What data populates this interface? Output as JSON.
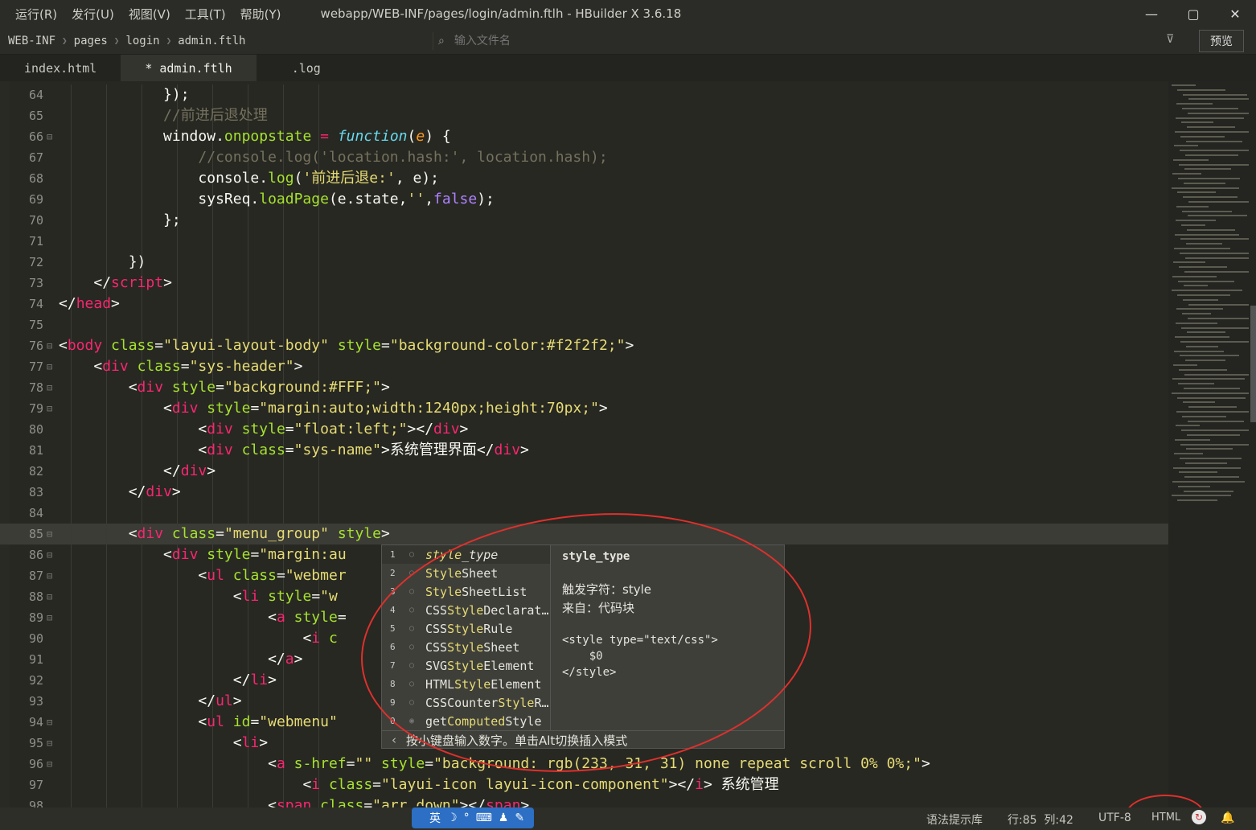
{
  "menubar": [
    "运行(R)",
    "发行(U)",
    "视图(V)",
    "工具(T)",
    "帮助(Y)"
  ],
  "window_title": "webapp/WEB-INF/pages/login/admin.ftlh - HBuilder X 3.6.18",
  "window_controls": {
    "minimize": "—",
    "maximize": "▢",
    "close": "✕"
  },
  "breadcrumb": [
    "WEB-INF",
    "pages",
    "login",
    "admin.ftlh"
  ],
  "file_search": {
    "placeholder": "输入文件名"
  },
  "preview_label": "预览",
  "tabs": [
    {
      "label": "index.html",
      "active": false
    },
    {
      "label": "* admin.ftlh",
      "active": true
    },
    {
      "label": ".log",
      "active": false
    }
  ],
  "editor": {
    "current_line": 85,
    "lines": [
      {
        "n": "64",
        "fold": false,
        "html": "            <span class='p'>});</span>"
      },
      {
        "n": "65",
        "fold": false,
        "html": "            <span class='c'>//前进后退处理</span>"
      },
      {
        "n": "66",
        "fold": true,
        "html": "            <span class='p'>window.</span><span class='a'>onpopstate</span> <span class='t'>=</span> <span class='f'>function</span><span class='p'>(</span><span class='v'>e</span><span class='p'>) {</span>"
      },
      {
        "n": "67",
        "fold": false,
        "html": "                <span class='c'>//console.log('location.hash:', location.hash);</span>"
      },
      {
        "n": "68",
        "fold": false,
        "html": "                <span class='p'>console.</span><span class='a'>log</span><span class='p'>(</span><span class='s'>'前进后退e:'</span><span class='p'>, e);</span>"
      },
      {
        "n": "69",
        "fold": false,
        "html": "                <span class='p'>sysReq.</span><span class='a'>loadPage</span><span class='p'>(e.state,</span><span class='s'>''</span><span class='p'>,</span><span class='k'>false</span><span class='p'>);</span>"
      },
      {
        "n": "70",
        "fold": false,
        "html": "            <span class='p'>};</span>"
      },
      {
        "n": "71",
        "fold": false,
        "html": ""
      },
      {
        "n": "72",
        "fold": false,
        "html": "        <span class='p'>})</span>"
      },
      {
        "n": "73",
        "fold": false,
        "html": "    <span class='p'>&lt;/</span><span class='t'>script</span><span class='p'>&gt;</span>"
      },
      {
        "n": "74",
        "fold": false,
        "html": "<span class='p'>&lt;/</span><span class='t'>head</span><span class='p'>&gt;</span>"
      },
      {
        "n": "75",
        "fold": false,
        "html": ""
      },
      {
        "n": "76",
        "fold": true,
        "html": "<span class='p'>&lt;</span><span class='t'>body</span> <span class='a'>class</span><span class='p'>=</span><span class='s'>\"layui-layout-body\"</span> <span class='a'>style</span><span class='p'>=</span><span class='s'>\"background-color:#f2f2f2;\"</span><span class='p'>&gt;</span>"
      },
      {
        "n": "77",
        "fold": true,
        "html": "    <span class='p'>&lt;</span><span class='t'>div</span> <span class='a'>class</span><span class='p'>=</span><span class='s'>\"sys-header\"</span><span class='p'>&gt;</span>"
      },
      {
        "n": "78",
        "fold": true,
        "html": "        <span class='p'>&lt;</span><span class='t'>div</span> <span class='a'>style</span><span class='p'>=</span><span class='s'>\"background:#FFF;\"</span><span class='p'>&gt;</span>"
      },
      {
        "n": "79",
        "fold": true,
        "html": "            <span class='p'>&lt;</span><span class='t'>div</span> <span class='a'>style</span><span class='p'>=</span><span class='s'>\"margin:auto;width:1240px;height:70px;\"</span><span class='p'>&gt;</span>"
      },
      {
        "n": "80",
        "fold": false,
        "html": "                <span class='p'>&lt;</span><span class='t'>div</span> <span class='a'>style</span><span class='p'>=</span><span class='s'>\"float:left;\"</span><span class='p'>&gt;&lt;/</span><span class='t'>div</span><span class='p'>&gt;</span>"
      },
      {
        "n": "81",
        "fold": false,
        "html": "                <span class='p'>&lt;</span><span class='t'>div</span> <span class='a'>class</span><span class='p'>=</span><span class='s'>\"sys-name\"</span><span class='p'>&gt;系统管理界面&lt;/</span><span class='t'>div</span><span class='p'>&gt;</span>"
      },
      {
        "n": "82",
        "fold": false,
        "html": "            <span class='p'>&lt;/</span><span class='t'>div</span><span class='p'>&gt;</span>"
      },
      {
        "n": "83",
        "fold": false,
        "html": "        <span class='p'>&lt;/</span><span class='t'>div</span><span class='p'>&gt;</span>"
      },
      {
        "n": "84",
        "fold": false,
        "html": ""
      },
      {
        "n": "85",
        "fold": true,
        "html": "        <span class='p'>&lt;</span><span class='t'>div</span> <span class='a'>class</span><span class='p'>=</span><span class='s'>\"menu_group\"</span> <span class='a'>style</span><span class='p'>&gt;</span>"
      },
      {
        "n": "86",
        "fold": true,
        "html": "            <span class='p'>&lt;</span><span class='t'>div</span> <span class='a'>style</span><span class='p'>=</span><span class='s'>\"margin:au</span>"
      },
      {
        "n": "87",
        "fold": true,
        "html": "                <span class='p'>&lt;</span><span class='t'>ul</span> <span class='a'>class</span><span class='p'>=</span><span class='s'>\"webmer</span>"
      },
      {
        "n": "88",
        "fold": true,
        "html": "                    <span class='p'>&lt;</span><span class='t'>li</span> <span class='a'>style</span><span class='p'>=</span><span class='s'>\"w</span>"
      },
      {
        "n": "89",
        "fold": true,
        "html": "                        <span class='p'>&lt;</span><span class='t'>a</span> <span class='a'>style</span><span class='p'>=</span>                                  <span class='a'>loading</span><span class='p'>&gt;</span>"
      },
      {
        "n": "90",
        "fold": false,
        "html": "                            <span class='p'>&lt;</span><span class='t'>i</span> <span class='a'>c</span>"
      },
      {
        "n": "91",
        "fold": false,
        "html": "                        <span class='p'>&lt;/</span><span class='t'>a</span><span class='p'>&gt;</span>"
      },
      {
        "n": "92",
        "fold": false,
        "html": "                    <span class='p'>&lt;/</span><span class='t'>li</span><span class='p'>&gt;</span>"
      },
      {
        "n": "93",
        "fold": false,
        "html": "                <span class='p'>&lt;/</span><span class='t'>ul</span><span class='p'>&gt;</span>"
      },
      {
        "n": "94",
        "fold": true,
        "html": "                <span class='p'>&lt;</span><span class='t'>ul</span> <span class='a'>id</span><span class='p'>=</span><span class='s'>\"webmenu\"</span>"
      },
      {
        "n": "95",
        "fold": true,
        "html": "                    <span class='p'>&lt;</span><span class='t'>li</span><span class='p'>&gt;</span>"
      },
      {
        "n": "96",
        "fold": true,
        "html": "                        <span class='p'>&lt;</span><span class='t'>a</span> <span class='a'>s-href</span><span class='p'>=</span><span class='s'>\"\"</span> <span class='a'>style</span><span class='p'>=</span><span class='s'>\"background: rgb(233, 31, 31) none repeat scroll 0% 0%;\"</span><span class='p'>&gt;</span>"
      },
      {
        "n": "97",
        "fold": false,
        "html": "                            <span class='p'>&lt;</span><span class='t'>i</span> <span class='a'>class</span><span class='p'>=</span><span class='s'>\"layui-icon layui-icon-component\"</span><span class='p'>&gt;&lt;/</span><span class='t'>i</span><span class='p'>&gt; 系统管理</span>"
      },
      {
        "n": "98",
        "fold": false,
        "html": "                        <span class='p'>&lt;</span><span class='t'>span</span> <span class='a'>class</span><span class='p'>=</span><span class='s'>\"arr_down\"</span><span class='p'>&gt;&lt;/</span><span class='t'>span</span><span class='p'>&gt;</span>"
      }
    ]
  },
  "autocomplete": {
    "items": [
      {
        "num": "1",
        "pre": "",
        "hl": "style",
        "post": "_type",
        "selected": true
      },
      {
        "num": "2",
        "pre": "",
        "hl": "Style",
        "post": "Sheet",
        "selected": false
      },
      {
        "num": "3",
        "pre": "",
        "hl": "Style",
        "post": "SheetList",
        "selected": false
      },
      {
        "num": "4",
        "pre": "CSS",
        "hl": "Style",
        "post": "Declarat…",
        "selected": false
      },
      {
        "num": "5",
        "pre": "CSS",
        "hl": "Style",
        "post": "Rule",
        "selected": false
      },
      {
        "num": "6",
        "pre": "CSS",
        "hl": "Style",
        "post": "Sheet",
        "selected": false
      },
      {
        "num": "7",
        "pre": "SVG",
        "hl": "Style",
        "post": "Element",
        "selected": false
      },
      {
        "num": "8",
        "pre": "HTML",
        "hl": "Style",
        "post": "Element",
        "selected": false
      },
      {
        "num": "9",
        "pre": "CSSCounter",
        "hl": "Style",
        "post": "R…",
        "selected": false
      },
      {
        "num": "0",
        "pre": "get",
        "hl": "Computed",
        "post": "Style",
        "selected": false
      }
    ],
    "detail_title": "style_type",
    "detail_trigger": "触发字符：style",
    "detail_source": "来自：代码块",
    "detail_code": "<style type=\"text/css\">\n    $0\n</style>",
    "footer": "按小键盘输入数字。单击Alt切换插入模式"
  },
  "statusbar": {
    "syntax_lib": "语法提示库",
    "position": "行:85  列:42",
    "encoding": "UTF-8",
    "language": "HTML"
  },
  "ime": {
    "label": "英"
  }
}
